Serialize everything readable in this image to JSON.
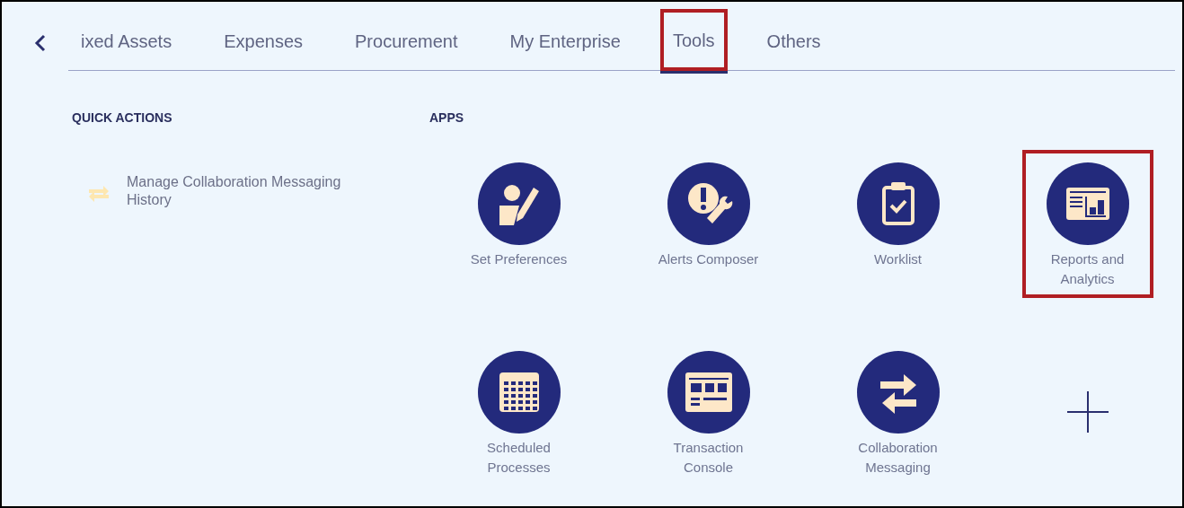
{
  "tabs": [
    {
      "label": "ixed Assets",
      "selected": false,
      "highlighted": false
    },
    {
      "label": "Expenses",
      "selected": false,
      "highlighted": false
    },
    {
      "label": "Procurement",
      "selected": false,
      "highlighted": false
    },
    {
      "label": "My Enterprise",
      "selected": false,
      "highlighted": false
    },
    {
      "label": "Tools",
      "selected": true,
      "highlighted": true
    },
    {
      "label": "Others",
      "selected": false,
      "highlighted": false
    }
  ],
  "quick_actions": {
    "heading": "QUICK ACTIONS",
    "items": [
      {
        "label": "Manage Collaboration Messaging History"
      }
    ]
  },
  "apps": {
    "heading": "APPS",
    "items": [
      {
        "kind": "preferences",
        "label": "Set Preferences",
        "highlighted": false
      },
      {
        "kind": "alerts",
        "label": "Alerts Composer",
        "highlighted": false
      },
      {
        "kind": "worklist",
        "label": "Worklist",
        "highlighted": false
      },
      {
        "kind": "reports",
        "label": "Reports and Analytics",
        "highlighted": true
      },
      {
        "kind": "calendar",
        "label": "Scheduled Processes",
        "highlighted": false
      },
      {
        "kind": "console",
        "label": "Transaction Console",
        "highlighted": false
      },
      {
        "kind": "swap",
        "label": "Collaboration Messaging",
        "highlighted": false
      },
      {
        "kind": "add"
      }
    ]
  }
}
